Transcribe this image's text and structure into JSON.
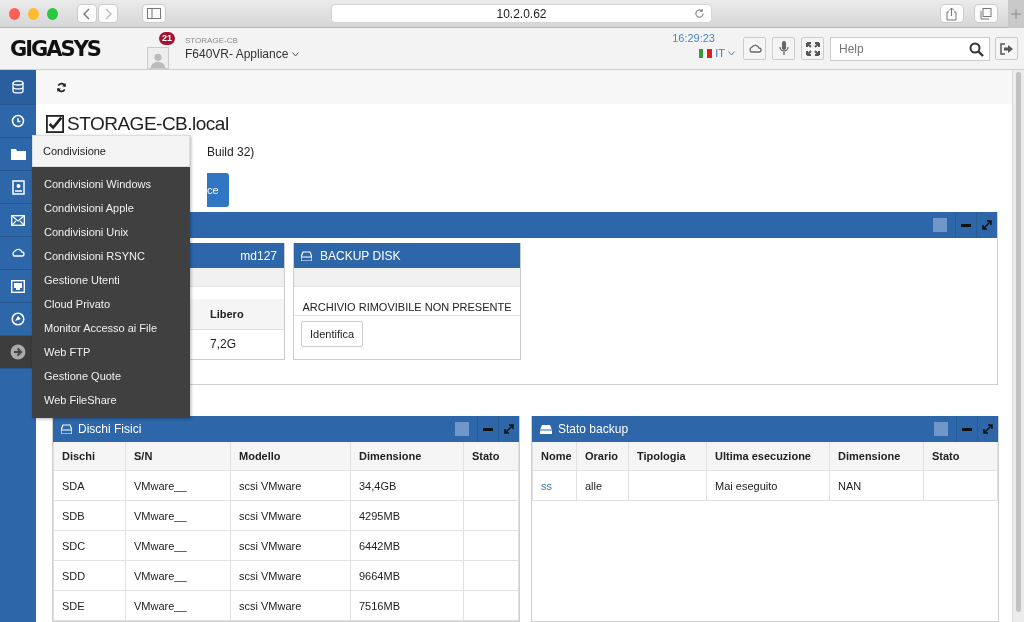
{
  "browser": {
    "address": "10.2.0.62"
  },
  "header": {
    "logo": "GIGASYS",
    "notification_count": "21",
    "host": "STORAGE-CB",
    "device": "F640VR- Appliance",
    "time": "16:29:23",
    "language": "IT",
    "help_search": {
      "placeholder": "Help"
    }
  },
  "page": {
    "title": "STORAGE-CB.local",
    "title_checked": true,
    "subtitle": "Build 32)",
    "action_button": "ce"
  },
  "flyout_menu": {
    "title": "Condivisione",
    "items": [
      "Condivisioni Windows",
      "Condivisioni Apple",
      "Condivisioni Unix",
      "Condivisioni RSYNC",
      "Gestione Utenti",
      "Cloud Privato",
      "Monitor Accesso ai File",
      "Web FTP",
      "Gestione Quote",
      "Web FileShare"
    ]
  },
  "storage_panel": {
    "volume_card": {
      "device": "md127",
      "column": "Libero",
      "value": "7,2G"
    },
    "backup_card": {
      "title": "BACKUP DISK",
      "message": "ARCHIVIO RIMOVIBILE NON PRESENTE",
      "button": "Identifica"
    }
  },
  "physical_disks": {
    "title": "Dischi Fisici",
    "columns": [
      "Dischi",
      "S/N",
      "Modello",
      "Dimensione",
      "Stato"
    ],
    "rows": [
      [
        "SDA",
        "VMware__",
        "scsi VMware",
        "34,4GB",
        null
      ],
      [
        "SDB",
        "VMware__",
        "scsi VMware",
        "4295MB",
        null
      ],
      [
        "SDC",
        "VMware__",
        "scsi VMware",
        "6442MB",
        null
      ],
      [
        "SDD",
        "VMware__",
        "scsi VMware",
        "9664MB",
        null
      ],
      [
        "SDE",
        "VMware__",
        "scsi VMware",
        "7516MB",
        null
      ]
    ]
  },
  "backup_status": {
    "title": "Stato backup",
    "columns": [
      "Nome",
      "Orario",
      "Tipologia",
      "Ultima esecuzione",
      "Dimensione",
      "Stato"
    ],
    "rows": [
      [
        "ss",
        "alle",
        null,
        "Mai eseguito",
        "NAN",
        null
      ]
    ]
  }
}
